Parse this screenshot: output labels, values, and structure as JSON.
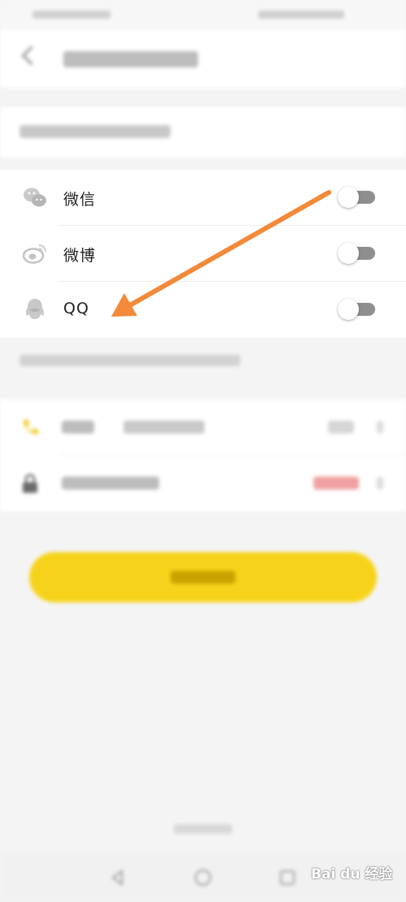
{
  "social_accounts": [
    {
      "label": "微信",
      "icon": "wechat-icon",
      "toggle_on": false
    },
    {
      "label": "微博",
      "icon": "weibo-icon",
      "toggle_on": false
    },
    {
      "label": "QQ",
      "icon": "qq-icon",
      "toggle_on": false
    }
  ],
  "overlay": {
    "arrow_color": "#f28a3a"
  },
  "colors": {
    "accent_button": "#f6d31a",
    "toggle_track": "#8e8e8e",
    "warning_text": "#e04040"
  },
  "watermark": {
    "text": "Bai du 经验"
  }
}
